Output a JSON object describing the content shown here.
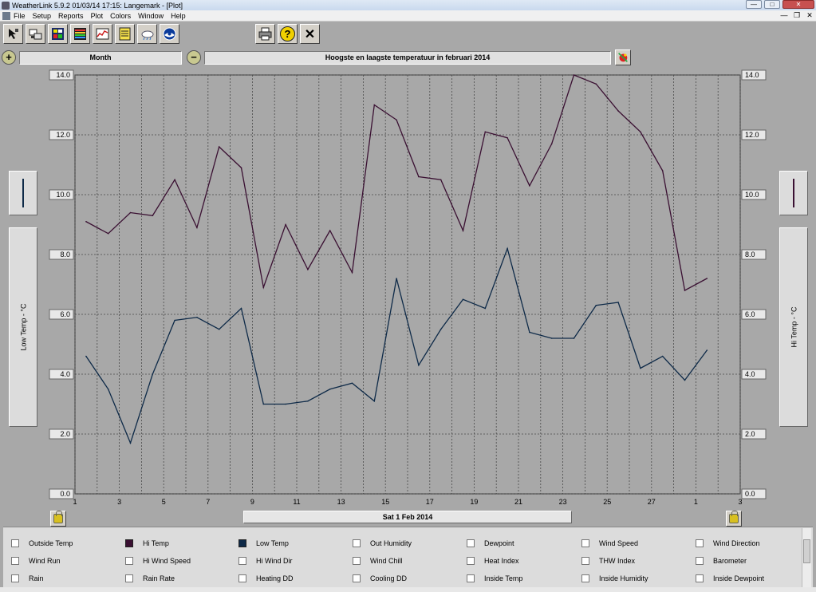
{
  "window": {
    "title": "WeatherLink 5.9.2  01/03/14  17:15: Langemark - [Plot]",
    "controls": [
      "—",
      "□",
      "✕"
    ]
  },
  "menu": [
    "File",
    "Setup",
    "Reports",
    "Plot",
    "Colors",
    "Window",
    "Help"
  ],
  "mdi_controls": [
    "—",
    "❐",
    "✕"
  ],
  "toolbar": {
    "icons": [
      "cursor-icon",
      "station-icon",
      "bulletin-icon",
      "summary-icon",
      "strip-chart-icon",
      "notes-icon",
      "noaa-cloud-icon",
      "noaa-logo-icon"
    ],
    "print_icon": "printer-icon",
    "help_label": "?",
    "close_label": "✕"
  },
  "zoom": {
    "zoom_in": "+",
    "zoom_out": "−",
    "period": "Month",
    "plot_title": "Hoogste en laagste temperatuur in februari 2014"
  },
  "left_axis_label": "Low Temp - °C",
  "right_axis_label": "Hi Temp - °C",
  "date_label": "Sat 1 Feb 2014",
  "colors": {
    "hi_temp": "#3a1032",
    "low_temp": "#0e2a48",
    "plot_bg": "#a8a8a8",
    "grid": "#4a4a4a"
  },
  "chart_data": {
    "type": "line",
    "ylim": [
      0,
      14
    ],
    "yticks": [
      "0.0",
      "2.0",
      "4.0",
      "6.0",
      "8.0",
      "10.0",
      "12.0",
      "14.0"
    ],
    "xticks": [
      "1",
      "3",
      "5",
      "7",
      "9",
      "11",
      "13",
      "15",
      "17",
      "19",
      "21",
      "23",
      "25",
      "27",
      "1",
      "3"
    ],
    "x": [
      1,
      2,
      3,
      4,
      5,
      6,
      7,
      8,
      9,
      10,
      11,
      12,
      13,
      14,
      15,
      16,
      17,
      18,
      19,
      20,
      21,
      22,
      23,
      24,
      25,
      26,
      27,
      28,
      29,
      30
    ],
    "series": [
      {
        "name": "Hi Temp",
        "values": [
          9.1,
          8.7,
          9.4,
          9.3,
          10.5,
          8.9,
          11.6,
          10.9,
          6.9,
          9.0,
          7.5,
          8.8,
          7.4,
          13.0,
          12.5,
          10.6,
          10.5,
          8.8,
          12.1,
          11.9,
          10.3,
          11.7,
          14.0,
          13.7,
          12.8,
          12.1,
          10.8,
          6.8,
          7.2,
          null
        ]
      },
      {
        "name": "Low Temp",
        "values": [
          4.6,
          3.5,
          1.7,
          4.0,
          5.8,
          5.9,
          5.5,
          6.2,
          3.0,
          3.0,
          3.1,
          3.5,
          3.7,
          3.1,
          7.2,
          4.3,
          5.5,
          6.5,
          6.2,
          8.2,
          5.4,
          5.2,
          5.2,
          6.3,
          6.4,
          4.2,
          4.6,
          3.8,
          4.8,
          null
        ]
      }
    ],
    "xlim": [
      1,
      31
    ]
  },
  "legend": [
    [
      "Outside Temp",
      "Hi Temp",
      "Low Temp",
      "Out Humidity",
      "Dewpoint",
      "Wind Speed",
      "Wind Direction"
    ],
    [
      "Wind Run",
      "Hi Wind Speed",
      "Hi Wind Dir",
      "Wind Chill",
      "Heat Index",
      "THW Index",
      "Barometer"
    ],
    [
      "Rain",
      "Rain Rate",
      "Heating DD",
      "Cooling DD",
      "Inside Temp",
      "Inside Humidity",
      "Inside Dewpoint"
    ]
  ]
}
